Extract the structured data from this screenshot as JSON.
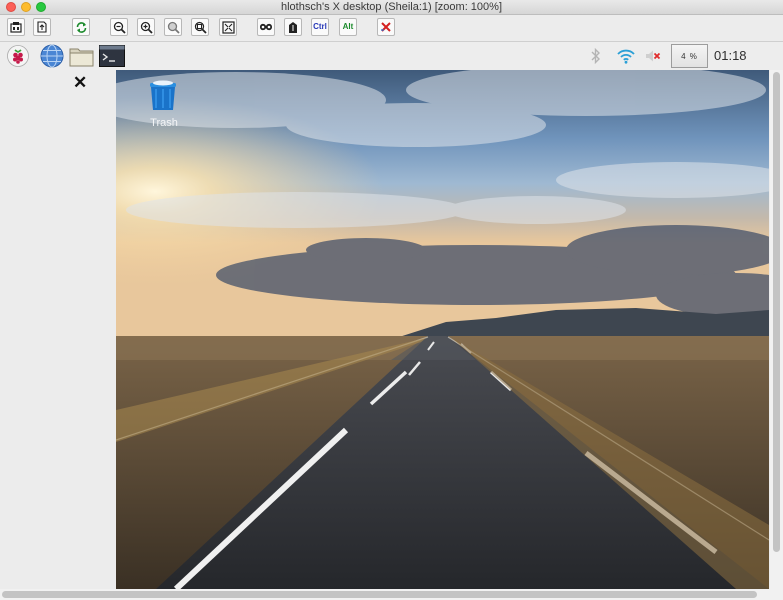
{
  "window": {
    "title": "hlothsch's X desktop (Sheila:1) [zoom: 100%]"
  },
  "toolbar": {
    "ctrl_label": "Ctrl",
    "alt_label": "Alt"
  },
  "panel": {
    "cpu_usage": "4 %",
    "clock": "01:18"
  },
  "desktop": {
    "trash_label": "Trash"
  },
  "close_glyph": "✕",
  "icons": [
    "info-icon",
    "file-transfer-icon",
    "refresh-icon",
    "zoom-out-icon",
    "zoom-in-icon",
    "zoom-reset-icon",
    "zoom-fit-icon",
    "fullscreen-icon",
    "ctrl-alt-del-icon",
    "send-keys-icon",
    "disconnect-icon",
    "raspberry-icon",
    "web-browser-icon",
    "file-manager-icon",
    "terminal-icon",
    "bluetooth-icon",
    "wifi-icon",
    "volume-muted-icon",
    "trash-icon"
  ],
  "colors": {
    "accent_wifi": "#2a9fd6",
    "disconnect": "#d42020",
    "raspberry": "#c51a4a"
  }
}
